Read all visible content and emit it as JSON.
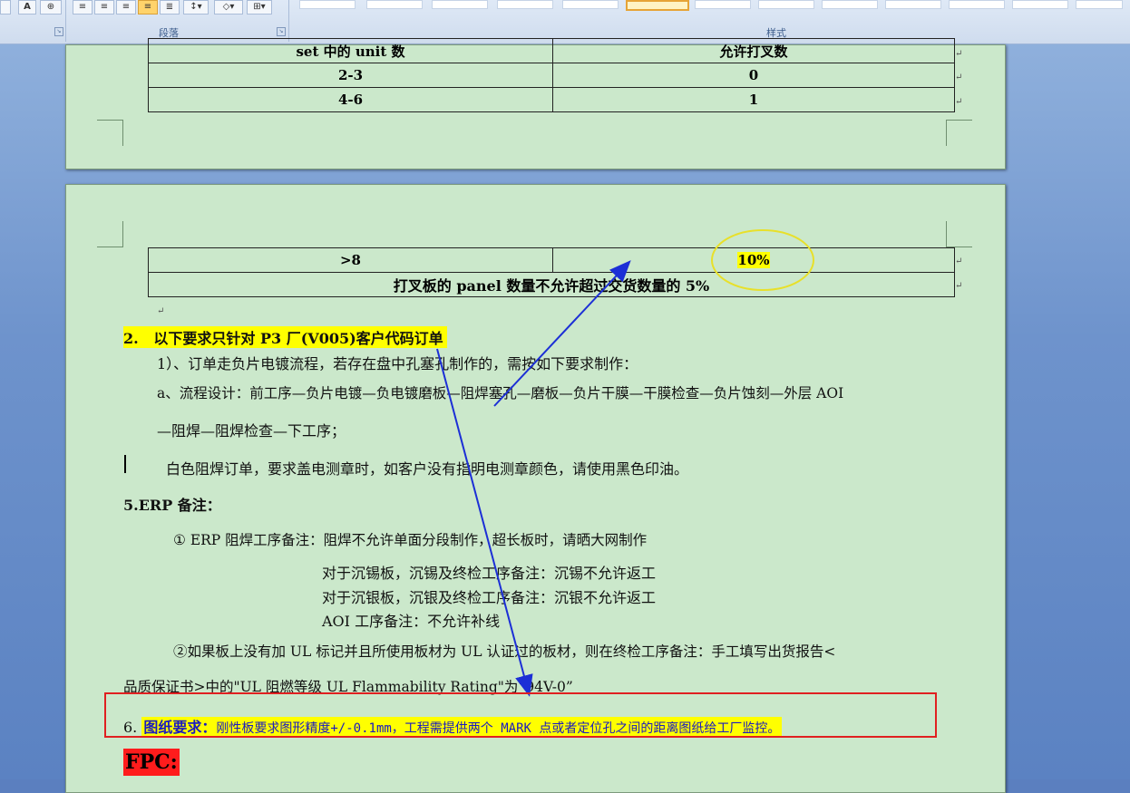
{
  "ribbon": {
    "font_a_icon": "A",
    "paragraph_group_label": "段落",
    "styles_group_label": "样式"
  },
  "page1": {
    "table": {
      "header": [
        "set 中的 unit 数",
        "允许打叉数"
      ],
      "rows": [
        [
          "2-3",
          "0"
        ],
        [
          "4-6",
          "1"
        ]
      ]
    }
  },
  "page2": {
    "table": {
      "row1": [
        ">8",
        "10%"
      ],
      "row2": "打叉板的 panel 数量不允许超过交货数量的 5%"
    },
    "section2": {
      "number": "2.",
      "title": "以下要求只针对 P3 厂(V005)客户代码订单",
      "line1": "1）、订单走负片电镀流程，若存在盘中孔塞孔制作的，需按如下要求制作：",
      "line2": "a、流程设计：前工序—负片电镀—负电镀磨板—阻焊塞孔—磨板—负片干膜—干膜检查—负片蚀刻—外层 AOI",
      "line3": "—阻焊—阻焊检查—下工序；",
      "line4": "白色阻焊订单，要求盖电测章时，如客户没有指明电测章颜色，请使用黑色印油。"
    },
    "section5": {
      "title": "5.ERP 备注：",
      "item1": "① ERP 阻焊工序备注：阻焊不允许单面分段制作，超长板时，请晒大网制作",
      "item1_sub1": "对于沉锡板，沉锡及终检工序备注：沉锡不允许返工",
      "item1_sub2": "对于沉银板，沉银及终检工序备注：沉银不允许返工",
      "item1_sub3": "AOI 工序备注：不允许补线",
      "item2_line1": "②如果板上没有加 UL 标记并且所使用板材为 UL 认证过的板材，则在终检工序备注：手工填写出货报告<",
      "item2_line2": "品质保证书>中的\"UL 阻燃等级 UL Flammability Rating\"为“94V-0”"
    },
    "section6": {
      "number": "6.",
      "title": "图纸要求：",
      "text": "刚性板要求图形精度+/-0.1mm，工程需提供两个 MARK 点或者定位孔之间的距离图纸给工厂监控。"
    },
    "fpc_label": "FPC:"
  },
  "colors": {
    "page_bg": "#cbe8cb",
    "highlight_yellow": "#ffff00",
    "annotation_blue": "#1c2fd6",
    "annotation_red": "#e02020",
    "ellipse_yellow": "#e8e02a"
  }
}
